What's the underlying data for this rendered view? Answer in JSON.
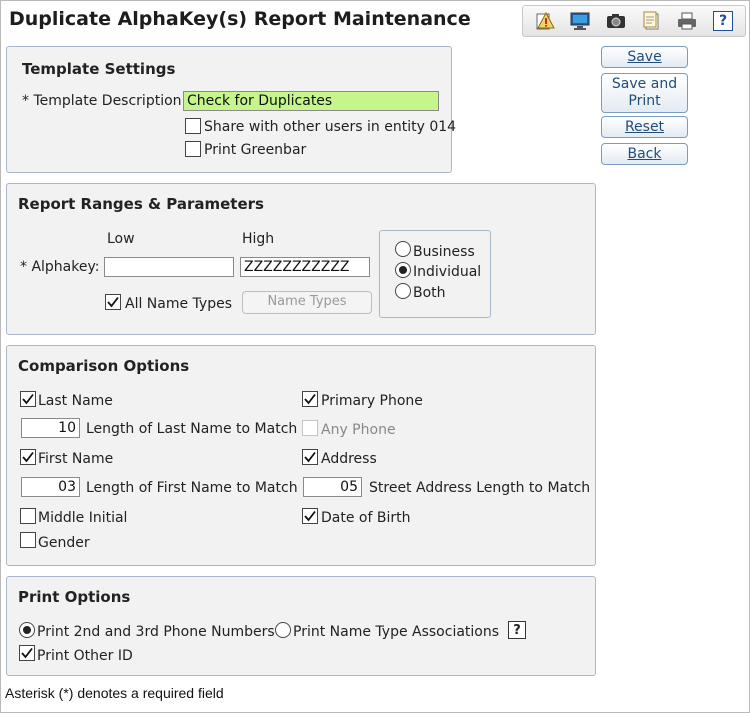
{
  "window": {
    "title": "Duplicate AlphaKey(s) Report Maintenance"
  },
  "toolbar": {
    "icons": [
      "alert-report-icon",
      "monitor-icon",
      "camera-icon",
      "notes-icon",
      "printer-icon",
      "help-icon"
    ],
    "help_label": "?"
  },
  "actions": {
    "save": "Save",
    "save_and_print_line1": "Save and",
    "save_and_print_line2": "Print",
    "reset": "Reset",
    "back": "Back"
  },
  "template_settings": {
    "title": "Template Settings",
    "description_label": "* Template Description:",
    "description_value": "Check for Duplicates",
    "share_label": "Share with other users in entity 014",
    "share_checked": false,
    "greenbar_label": "Print Greenbar",
    "greenbar_checked": false
  },
  "report_ranges": {
    "title": "Report Ranges & Parameters",
    "low_label": "Low",
    "high_label": "High",
    "alphakey_label": "* Alphakey:",
    "alphakey_low": "",
    "alphakey_high": "ZZZZZZZZZZZ",
    "all_name_types_label": "All Name Types",
    "all_name_types_checked": true,
    "name_types_button": "Name Types",
    "entity_options": [
      "Business",
      "Individual",
      "Both"
    ],
    "entity_selected": "Individual"
  },
  "comparison": {
    "title": "Comparison Options",
    "last_name": "Last Name",
    "last_name_length": "10",
    "last_name_length_label": "Length of Last Name to Match",
    "first_name": "First Name",
    "first_name_length": "03",
    "first_name_length_label": "Length of First Name to Match",
    "middle_initial": "Middle Initial",
    "gender": "Gender",
    "primary_phone": "Primary Phone",
    "any_phone": "Any Phone",
    "address": "Address",
    "street_length": "05",
    "street_length_label": "Street Address Length to Match",
    "date_of_birth": "Date of Birth"
  },
  "print_options": {
    "title": "Print Options",
    "phone_numbers": "Print 2nd and 3rd Phone Numbers",
    "name_type_assoc": "Print Name Type Associations",
    "selected": "phone_numbers",
    "help_label": "?",
    "other_id": "Print Other ID",
    "other_id_checked": true
  },
  "footer": {
    "note": "Asterisk (*) denotes a required field"
  }
}
